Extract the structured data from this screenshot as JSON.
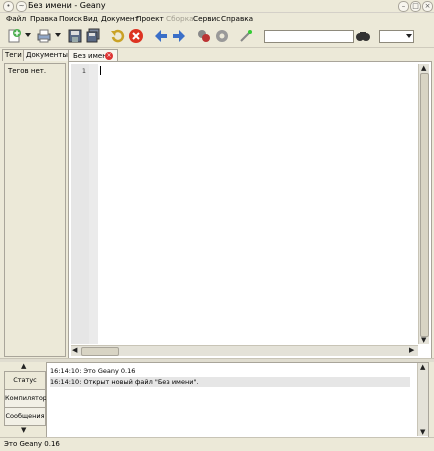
{
  "window": {
    "title": "Без имени - Geany"
  },
  "menu": [
    "Файл",
    "Правка",
    "Поиск",
    "Вид",
    "Документ",
    "Проект",
    "Сборка",
    "Сервис",
    "Справка"
  ],
  "menu_disabled": [
    "Сборка"
  ],
  "toolbar": {
    "icons": [
      "new-file-icon",
      "print-icon",
      "save-icon",
      "save-all-icon",
      "revert-icon",
      "close-icon",
      "back-icon",
      "forward-icon",
      "compile-icon",
      "settings-icon",
      "color-picker-icon",
      "search-icon"
    ],
    "search_value": "",
    "goto_value": ""
  },
  "sidebar": {
    "tabs": [
      "Теги",
      "Документы"
    ],
    "empty_text": "Тегов нет."
  },
  "editor": {
    "tab_label": "Без имени",
    "line_number": "1"
  },
  "bottom": {
    "tabs": [
      "Статус",
      "Компилятор",
      "Сообщения"
    ],
    "messages": [
      "16:14:10: Это Geany 0.16",
      "16:14:10: Открыт новый файл \"Без имени\"."
    ]
  },
  "status": {
    "text": "Это Geany 0.16"
  },
  "colors": {
    "background": "#ece9d8",
    "editor_bg": "#ffffff",
    "close_red": "#dd3333",
    "nav_blue": "#3a6fc8"
  }
}
